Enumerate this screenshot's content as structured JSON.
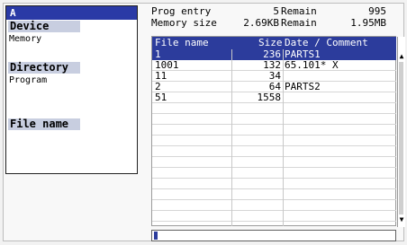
{
  "panel": {
    "title": "A",
    "device_label": "Device",
    "device_value": "Memory",
    "directory_label": "Directory",
    "directory_value": "Program",
    "filename_label": "File name",
    "filename_value": ""
  },
  "info": {
    "prog_entry_label": "Prog entry",
    "prog_entry_value": "5",
    "remain1_label": "Remain",
    "remain1_value": "995",
    "memory_size_label": "Memory size",
    "memory_size_value": "2.69KB",
    "remain2_label": "Remain",
    "remain2_value": "1.95MB"
  },
  "table": {
    "headers": {
      "name": "File name",
      "size": "Size",
      "comment": "Date / Comment"
    },
    "rows": [
      {
        "name": "1",
        "size": "236",
        "comment": "PARTS1",
        "selected": true
      },
      {
        "name": "1001",
        "size": "132",
        "comment": "65.101* X",
        "selected": false
      },
      {
        "name": "11",
        "size": "34",
        "comment": "",
        "selected": false
      },
      {
        "name": "2",
        "size": "64",
        "comment": "PARTS2",
        "selected": false
      },
      {
        "name": "51",
        "size": "1558",
        "comment": "",
        "selected": false
      },
      {
        "name": "",
        "size": "",
        "comment": ""
      },
      {
        "name": "",
        "size": "",
        "comment": ""
      },
      {
        "name": "",
        "size": "",
        "comment": ""
      },
      {
        "name": "",
        "size": "",
        "comment": ""
      },
      {
        "name": "",
        "size": "",
        "comment": ""
      },
      {
        "name": "",
        "size": "",
        "comment": ""
      },
      {
        "name": "",
        "size": "",
        "comment": ""
      },
      {
        "name": "",
        "size": "",
        "comment": ""
      },
      {
        "name": "",
        "size": "",
        "comment": ""
      },
      {
        "name": "",
        "size": "",
        "comment": ""
      },
      {
        "name": "",
        "size": "",
        "comment": ""
      }
    ]
  },
  "input": {
    "value": ""
  },
  "icons": {
    "scroll_up": "scroll-up-arrow-icon",
    "scroll_down": "scroll-down-arrow-icon"
  }
}
